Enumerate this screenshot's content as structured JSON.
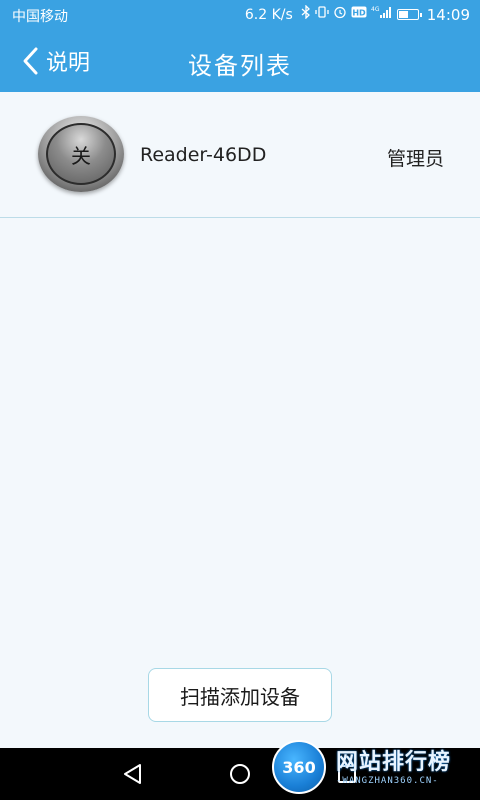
{
  "status_bar": {
    "carrier": "中国移动",
    "net_speed": "6.2 K/s",
    "time": "14:09",
    "icons": [
      "bluetooth-icon",
      "vibrate-icon",
      "alarm-icon",
      "hd-icon",
      "4g-signal-icon",
      "battery-icon"
    ]
  },
  "appbar": {
    "back_label": "说明",
    "title": "设备列表"
  },
  "devices": [
    {
      "switch_label": "关",
      "name": "Reader-46DD",
      "role": "管理员"
    }
  ],
  "scan_button_label": "扫描添加设备",
  "watermark": {
    "logo_text": "360",
    "title": "网站排行榜",
    "subtitle": "-WANGZHAN360.CN-"
  },
  "colors": {
    "header": "#3aa2e2",
    "background": "#f3f8fc",
    "navbar": "#000000"
  }
}
